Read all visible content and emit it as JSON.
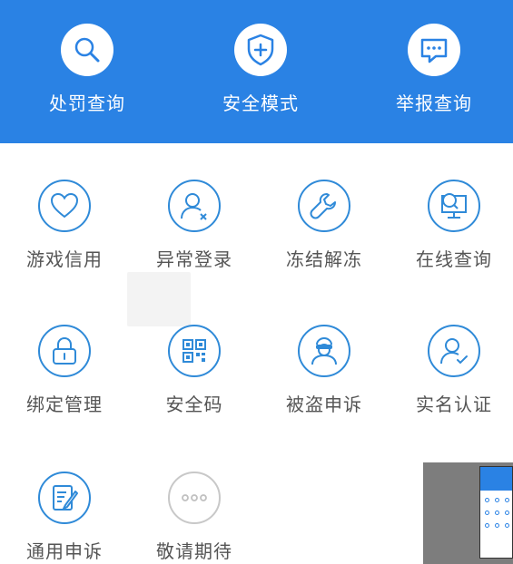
{
  "top_menu": {
    "items": [
      {
        "label": "处罚查询",
        "icon": "search-icon"
      },
      {
        "label": "安全模式",
        "icon": "shield-plus-icon"
      },
      {
        "label": "举报查询",
        "icon": "chat-bubble-icon"
      }
    ]
  },
  "grid": {
    "rows": [
      [
        {
          "label": "游戏信用",
          "icon": "heart-icon"
        },
        {
          "label": "异常登录",
          "icon": "user-x-icon"
        },
        {
          "label": "冻结解冻",
          "icon": "wrench-icon"
        },
        {
          "label": "在线查询",
          "icon": "monitor-search-icon"
        }
      ],
      [
        {
          "label": "绑定管理",
          "icon": "lock-icon"
        },
        {
          "label": "安全码",
          "icon": "qr-code-icon"
        },
        {
          "label": "被盗申诉",
          "icon": "thief-icon"
        },
        {
          "label": "实名认证",
          "icon": "user-check-icon"
        }
      ],
      [
        {
          "label": "通用申诉",
          "icon": "edit-document-icon"
        },
        {
          "label": "敬请期待",
          "icon": "more-dots-icon"
        }
      ]
    ]
  },
  "colors": {
    "banner": "#2a82e4",
    "icon_blue": "#2f8ad8",
    "label_grey": "#555555",
    "disabled_grey": "#c8c8c8"
  }
}
